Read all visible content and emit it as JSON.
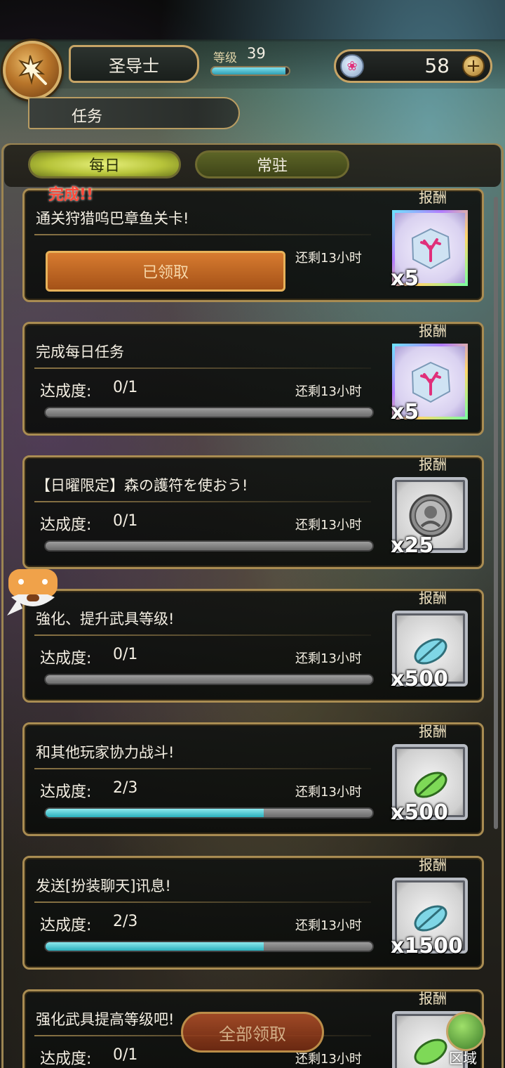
{
  "header": {
    "player_name": "圣导士",
    "level_label": "等级",
    "level_value": "39",
    "level_progress": 0.95,
    "gem_count": "58",
    "gem_plus": "+"
  },
  "section_title": "任务",
  "tabs": {
    "daily": "每日",
    "permanent": "常驻"
  },
  "reward_label": "报酬",
  "progress_label": "达成度:",
  "quests": [
    {
      "title": "通关狩猎呜巴章鱼关卡!",
      "status_tag": "完成!!",
      "claimed_label": "已领取",
      "time_left": "还剩13小时",
      "reward_qty": "x5",
      "reward_icon": "coral-gem-icon"
    },
    {
      "title": "完成每日任务",
      "progress": "0/1",
      "progress_value": 0,
      "time_left": "还剩13小时",
      "reward_qty": "x5",
      "reward_icon": "coral-gem-icon"
    },
    {
      "title": "【日曜限定】森の護符を使おう!",
      "progress": "0/1",
      "progress_value": 0,
      "time_left": "还剩13小时",
      "reward_qty": "x25",
      "reward_icon": "silver-medal-icon"
    },
    {
      "title": "強化、提升武具等级!",
      "progress": "0/1",
      "progress_value": 0,
      "time_left": "还剩13小时",
      "reward_qty": "x500",
      "reward_icon": "blue-leaf-icon"
    },
    {
      "title": "和其他玩家协力战斗!",
      "progress": "2/3",
      "progress_value": 0.667,
      "time_left": "还剩13小时",
      "reward_qty": "x500",
      "reward_icon": "green-leaf-icon"
    },
    {
      "title": "发送[扮装聊天]讯息!",
      "progress": "2/3",
      "progress_value": 0.667,
      "time_left": "还剩13小时",
      "reward_qty": "x1500",
      "reward_icon": "blue-leaf-icon"
    },
    {
      "title": "强化武具提高等级吧!",
      "progress": "0/1",
      "progress_value": 0,
      "time_left": "还剩13小时",
      "reward_qty": "",
      "reward_icon": "green-leaf-icon"
    }
  ],
  "claim_all": "全部领取",
  "region": "区域"
}
